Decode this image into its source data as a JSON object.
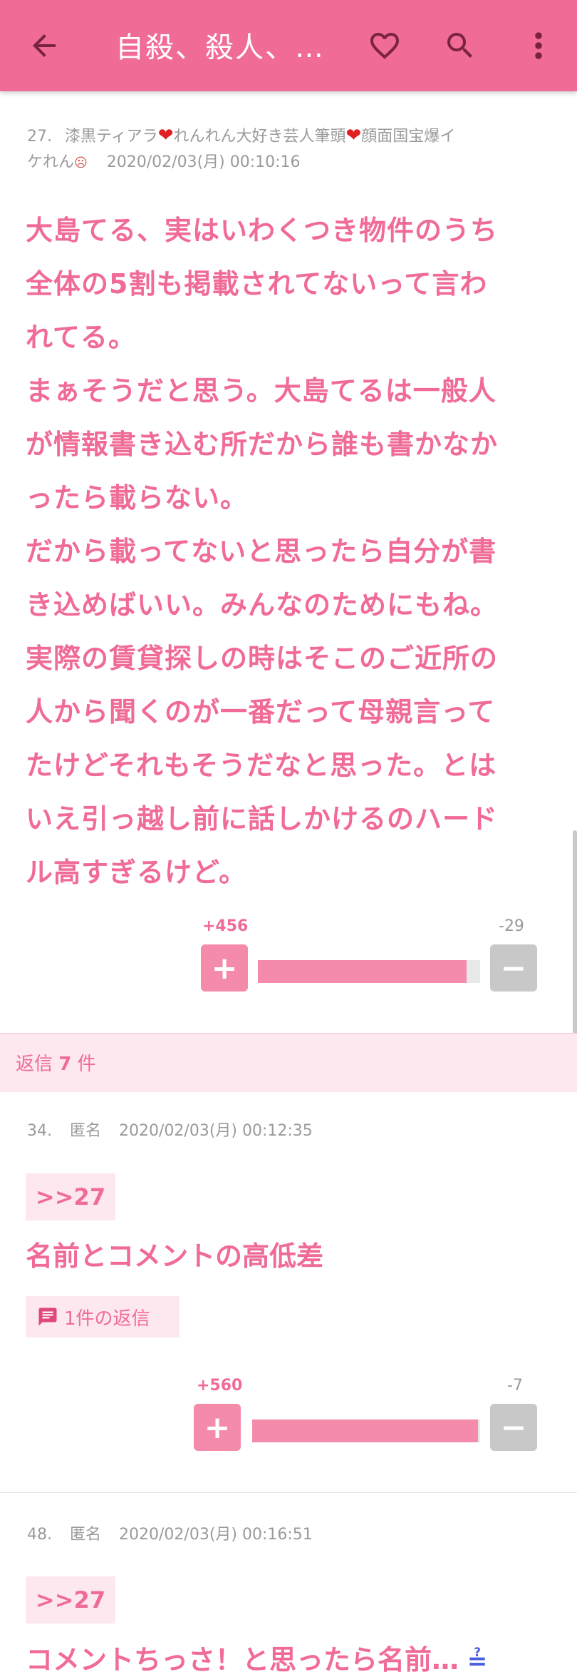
{
  "appbar": {
    "title": "自殺、殺人、…",
    "icons": [
      "back-arrow-icon",
      "heart-icon",
      "search-icon",
      "more-vertical-icon"
    ],
    "color": "#f06b96"
  },
  "comment_main": {
    "number": "27.",
    "name_parts": [
      "漆黒ティアラ",
      "れんれん大好き芸人筆頭",
      "顔面国宝爆イ",
      "ケれん"
    ],
    "date": "2020/02/03(月) 00:10:16",
    "text_lines": [
      "大島てる、実はいわくつき物件のうち",
      "全体の5割も掲載されてないって言わ",
      "れてる。",
      "まぁそうだと思う。大島てるは一般人",
      "が情報書き込む所だから誰も書かなか",
      "ったら載らない。",
      "だから載ってないと思ったら自分が書",
      "き込めばいい。みんなのためにもね。",
      "実際の賃貸探しの時はそこのご近所の",
      "人から聞くのが一番だって母親言って",
      "たけどそれもそうだなと思った。とは",
      "いえ引っ越し前に話しかけるのハード",
      "ル高すぎるけど。"
    ],
    "plus_count": "+456",
    "minus_count": "-29",
    "plus_fraction": 0.94
  },
  "reply_band": {
    "prefix": "返信",
    "count": "7",
    "suffix": "件"
  },
  "reply_1": {
    "number": "34.",
    "name": "匿名",
    "date": "2020/02/03(月) 00:12:35",
    "anchor": ">>27",
    "text": "名前とコメントの高低差",
    "reply_chip": "1件の返信",
    "plus_count": "+560",
    "minus_count": "-7",
    "plus_fraction": 0.99
  },
  "reply_2": {
    "number": "48.",
    "name": "匿名",
    "date": "2020/02/03(月) 00:16:51",
    "anchor": ">>27",
    "text": "コメントちっさ！と思ったら名前…"
  },
  "colors": {
    "accent": "#f06b96",
    "vote_plus": "#f48bab",
    "vote_minus": "#c8c8c8",
    "reply_bg": "#fde8ef"
  }
}
